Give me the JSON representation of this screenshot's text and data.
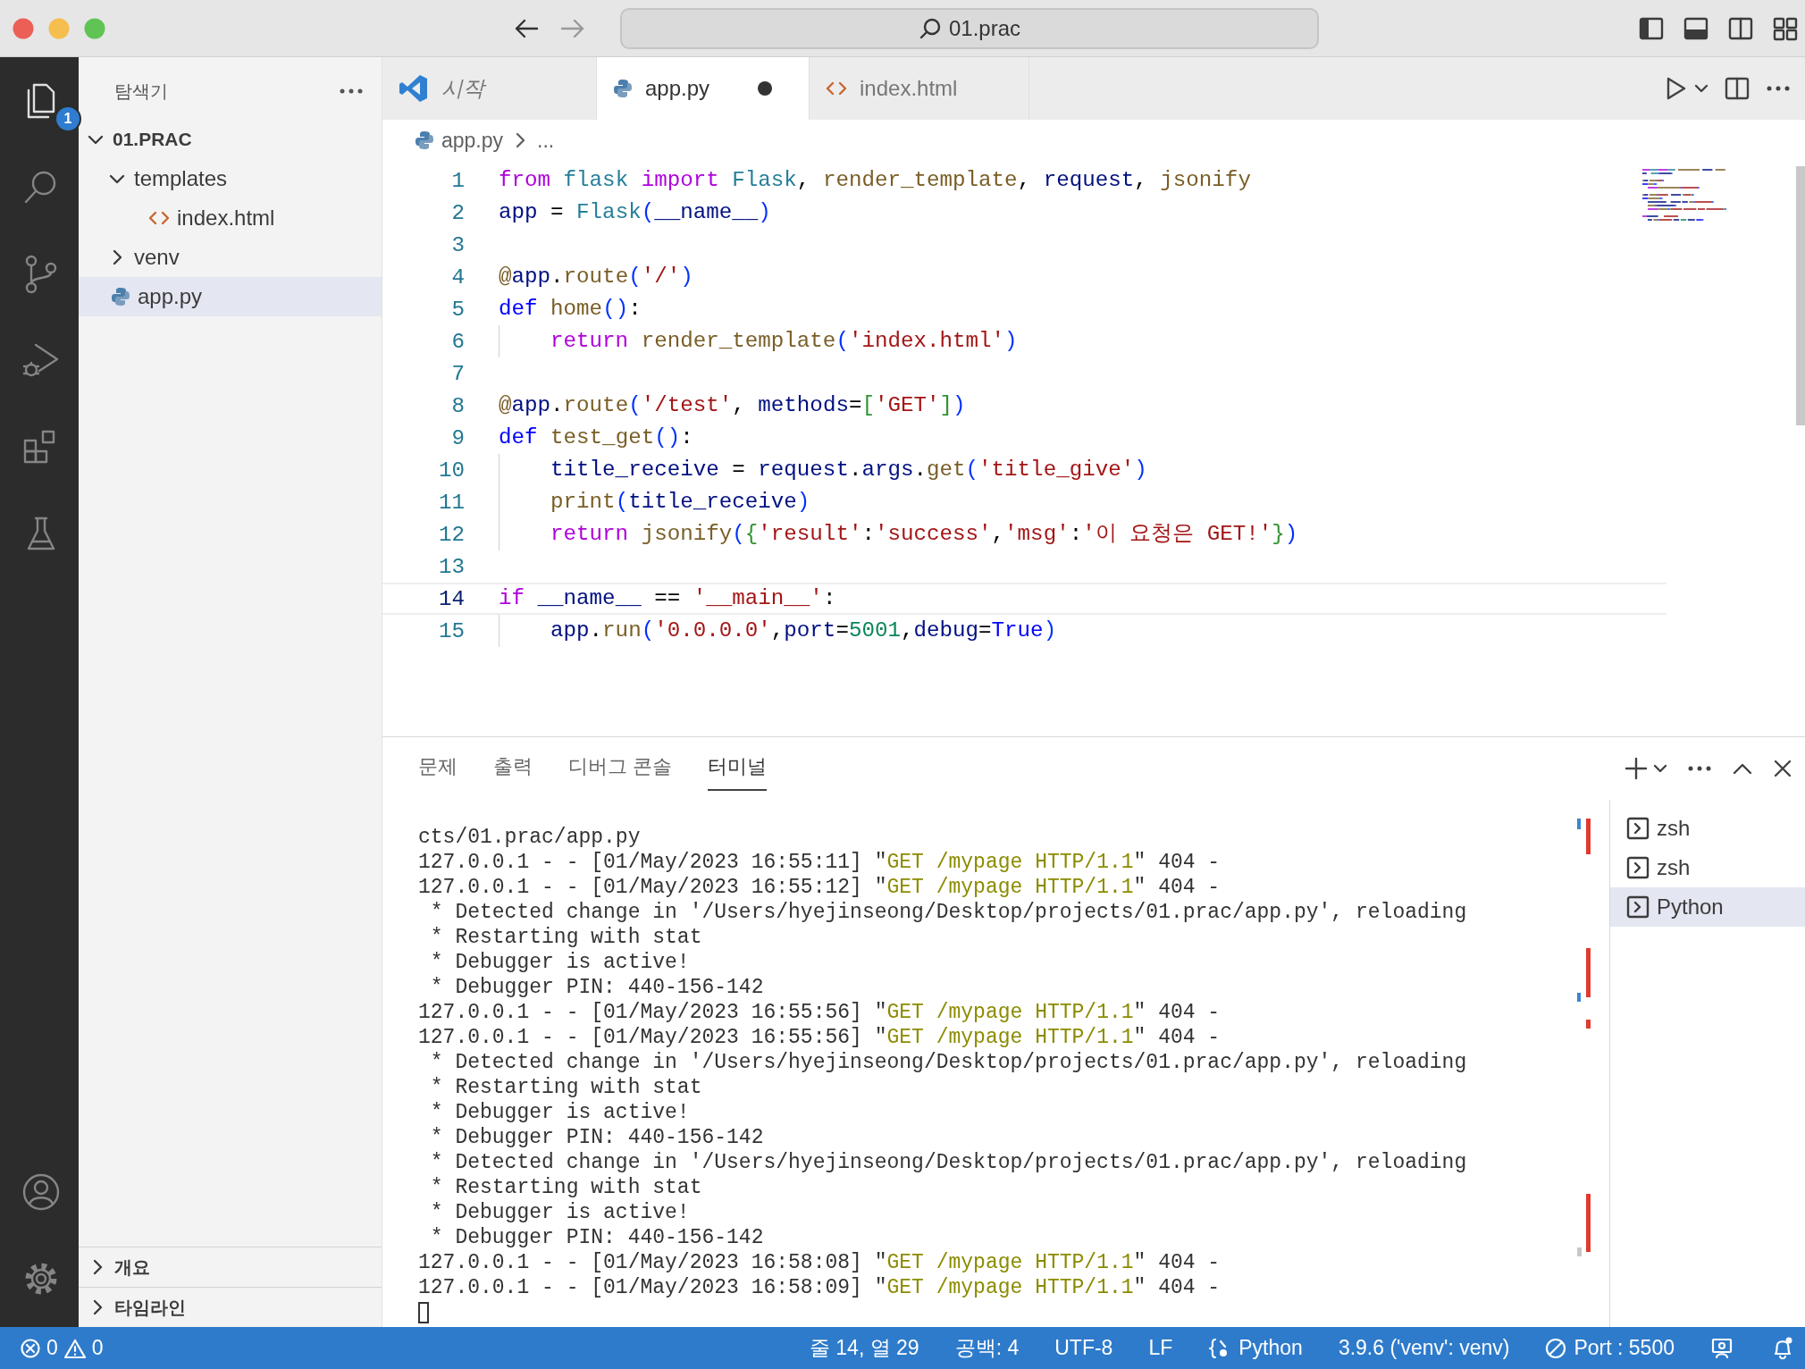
{
  "window": {
    "title": "01.prac"
  },
  "activity_bar": {
    "items": [
      {
        "kind": "explorer",
        "selected": true,
        "badge": "1"
      },
      {
        "kind": "search",
        "selected": false
      },
      {
        "kind": "source-control",
        "selected": false
      },
      {
        "kind": "run-debug",
        "selected": false
      },
      {
        "kind": "extensions",
        "selected": false
      },
      {
        "kind": "testing",
        "selected": false
      }
    ],
    "bottom": [
      {
        "kind": "account"
      },
      {
        "kind": "settings"
      }
    ]
  },
  "sidebar": {
    "title": "탐색기",
    "tree": [
      {
        "label": "01.PRAC",
        "kind": "root",
        "expanded": true,
        "selected": false,
        "children": [
          {
            "label": "templates",
            "kind": "folder",
            "expanded": true,
            "selected": false,
            "children": [
              {
                "label": "index.html",
                "kind": "html",
                "selected": false
              }
            ]
          },
          {
            "label": "venv",
            "kind": "folder",
            "expanded": false,
            "selected": false
          },
          {
            "label": "app.py",
            "kind": "python",
            "selected": true
          }
        ]
      }
    ],
    "sections": [
      {
        "label": "개요",
        "expanded": false
      },
      {
        "label": "타임라인",
        "expanded": false
      }
    ]
  },
  "tabs": [
    {
      "label": "시작",
      "kind": "welcome",
      "selected": false,
      "modified": false
    },
    {
      "label": "app.py",
      "kind": "python",
      "selected": true,
      "modified": true
    },
    {
      "label": "index.html",
      "kind": "html",
      "selected": false,
      "modified": false
    }
  ],
  "breadcrumb": {
    "items": [
      "app.py",
      "..."
    ]
  },
  "editor": {
    "lines": [
      {
        "number": "1",
        "current": false,
        "indented": false,
        "tokens": [
          {
            "kind": "keyword",
            "text": "from "
          },
          {
            "kind": "class",
            "text": "flask "
          },
          {
            "kind": "keyword",
            "text": "import "
          },
          {
            "kind": "class",
            "text": "Flask"
          },
          {
            "kind": "plain",
            "text": ", "
          },
          {
            "kind": "function",
            "text": "render_template"
          },
          {
            "kind": "plain",
            "text": ", "
          },
          {
            "kind": "variable",
            "text": "request"
          },
          {
            "kind": "plain",
            "text": ", "
          },
          {
            "kind": "function",
            "text": "jsonify"
          }
        ]
      },
      {
        "number": "2",
        "current": false,
        "indented": false,
        "tokens": [
          {
            "kind": "variable",
            "text": "app"
          },
          {
            "kind": "plain",
            "text": " = "
          },
          {
            "kind": "class",
            "text": "Flask"
          },
          {
            "kind": "bracket",
            "text": "("
          },
          {
            "kind": "variable",
            "text": "__name__"
          },
          {
            "kind": "bracket",
            "text": ")"
          }
        ]
      },
      {
        "number": "3",
        "current": false,
        "indented": false
      },
      {
        "number": "4",
        "current": false,
        "indented": false,
        "tokens": [
          {
            "kind": "function",
            "text": "@"
          },
          {
            "kind": "variable",
            "text": "app"
          },
          {
            "kind": "plain",
            "text": "."
          },
          {
            "kind": "function",
            "text": "route"
          },
          {
            "kind": "bracket",
            "text": "("
          },
          {
            "kind": "string",
            "text": "'/'"
          },
          {
            "kind": "bracket",
            "text": ")"
          }
        ]
      },
      {
        "number": "5",
        "current": false,
        "indented": false,
        "tokens": [
          {
            "kind": "storage",
            "text": "def "
          },
          {
            "kind": "function",
            "text": "home"
          },
          {
            "kind": "bracket",
            "text": "()"
          },
          {
            "kind": "plain",
            "text": ":"
          }
        ]
      },
      {
        "number": "6",
        "current": false,
        "indented": true,
        "tokens": [
          {
            "kind": "keyword",
            "text": "return "
          },
          {
            "kind": "function",
            "text": "render_template"
          },
          {
            "kind": "bracket",
            "text": "("
          },
          {
            "kind": "string",
            "text": "'index.html'"
          },
          {
            "kind": "bracket",
            "text": ")"
          }
        ]
      },
      {
        "number": "7",
        "current": false,
        "indented": false
      },
      {
        "number": "8",
        "current": false,
        "indented": false,
        "tokens": [
          {
            "kind": "function",
            "text": "@"
          },
          {
            "kind": "variable",
            "text": "app"
          },
          {
            "kind": "plain",
            "text": "."
          },
          {
            "kind": "function",
            "text": "route"
          },
          {
            "kind": "bracket",
            "text": "("
          },
          {
            "kind": "string",
            "text": "'/test'"
          },
          {
            "kind": "plain",
            "text": ", "
          },
          {
            "kind": "variable",
            "text": "methods"
          },
          {
            "kind": "plain",
            "text": "="
          },
          {
            "kind": "bracket2",
            "text": "["
          },
          {
            "kind": "string",
            "text": "'GET'"
          },
          {
            "kind": "bracket2",
            "text": "]"
          },
          {
            "kind": "bracket",
            "text": ")"
          }
        ]
      },
      {
        "number": "9",
        "current": false,
        "indented": false,
        "tokens": [
          {
            "kind": "storage",
            "text": "def "
          },
          {
            "kind": "function",
            "text": "test_get"
          },
          {
            "kind": "bracket",
            "text": "()"
          },
          {
            "kind": "plain",
            "text": ":"
          }
        ]
      },
      {
        "number": "10",
        "current": false,
        "indented": true,
        "tokens": [
          {
            "kind": "variable",
            "text": "title_receive"
          },
          {
            "kind": "plain",
            "text": " = "
          },
          {
            "kind": "variable",
            "text": "request"
          },
          {
            "kind": "plain",
            "text": "."
          },
          {
            "kind": "variable",
            "text": "args"
          },
          {
            "kind": "plain",
            "text": "."
          },
          {
            "kind": "function",
            "text": "get"
          },
          {
            "kind": "bracket",
            "text": "("
          },
          {
            "kind": "string",
            "text": "'title_give'"
          },
          {
            "kind": "bracket",
            "text": ")"
          }
        ]
      },
      {
        "number": "11",
        "current": false,
        "indented": true,
        "tokens": [
          {
            "kind": "function",
            "text": "print"
          },
          {
            "kind": "bracket",
            "text": "("
          },
          {
            "kind": "variable",
            "text": "title_receive"
          },
          {
            "kind": "bracket",
            "text": ")"
          }
        ]
      },
      {
        "number": "12",
        "current": false,
        "indented": true,
        "tokens": [
          {
            "kind": "keyword",
            "text": "return "
          },
          {
            "kind": "function",
            "text": "jsonify"
          },
          {
            "kind": "bracket",
            "text": "("
          },
          {
            "kind": "bracket2",
            "text": "{"
          },
          {
            "kind": "string",
            "text": "'result'"
          },
          {
            "kind": "plain",
            "text": ":"
          },
          {
            "kind": "string",
            "text": "'success'"
          },
          {
            "kind": "plain",
            "text": ","
          },
          {
            "kind": "string",
            "text": "'msg'"
          },
          {
            "kind": "plain",
            "text": ":"
          },
          {
            "kind": "string",
            "text": "'이 요청은 GET!'"
          },
          {
            "kind": "bracket2",
            "text": "}"
          },
          {
            "kind": "bracket",
            "text": ")"
          }
        ]
      },
      {
        "number": "13",
        "current": false,
        "indented": false
      },
      {
        "number": "14",
        "current": true,
        "indented": false,
        "tokens": [
          {
            "kind": "keyword",
            "text": "if "
          },
          {
            "kind": "variable",
            "text": "__name__"
          },
          {
            "kind": "plain",
            "text": " == "
          },
          {
            "kind": "string",
            "text": "'__main__'"
          },
          {
            "kind": "plain",
            "text": ":"
          }
        ]
      },
      {
        "number": "15",
        "current": false,
        "indented": true,
        "tokens": [
          {
            "kind": "variable",
            "text": "app"
          },
          {
            "kind": "plain",
            "text": "."
          },
          {
            "kind": "function",
            "text": "run"
          },
          {
            "kind": "bracket",
            "text": "("
          },
          {
            "kind": "string",
            "text": "'0.0.0.0'"
          },
          {
            "kind": "plain",
            "text": ","
          },
          {
            "kind": "variable",
            "text": "port"
          },
          {
            "kind": "plain",
            "text": "="
          },
          {
            "kind": "number",
            "text": "5001"
          },
          {
            "kind": "plain",
            "text": ","
          },
          {
            "kind": "variable",
            "text": "debug"
          },
          {
            "kind": "plain",
            "text": "="
          },
          {
            "kind": "storage",
            "text": "True"
          },
          {
            "kind": "bracket",
            "text": ")"
          }
        ]
      }
    ]
  },
  "panel": {
    "tabs": [
      {
        "label": "문제",
        "selected": false
      },
      {
        "label": "출력",
        "selected": false
      },
      {
        "label": "디버그 콘솔",
        "selected": false
      },
      {
        "label": "터미널",
        "selected": true
      }
    ],
    "terminal": {
      "lines": [
        [
          {
            "kind": "plain",
            "text": "cts/01.prac/app.py"
          }
        ],
        [
          {
            "kind": "plain",
            "text": "127.0.0.1 - - [01/May/2023 16:55:11] \""
          },
          {
            "kind": "request",
            "text": "GET /mypage HTTP/1.1"
          },
          {
            "kind": "plain",
            "text": "\" 404 -"
          }
        ],
        [
          {
            "kind": "plain",
            "text": "127.0.0.1 - - [01/May/2023 16:55:12] \""
          },
          {
            "kind": "request",
            "text": "GET /mypage HTTP/1.1"
          },
          {
            "kind": "plain",
            "text": "\" 404 -"
          }
        ],
        [
          {
            "kind": "plain",
            "text": " * Detected change in '/Users/hyejinseong/Desktop/projects/01.prac/app.py', reloading"
          }
        ],
        [
          {
            "kind": "plain",
            "text": " * Restarting with stat"
          }
        ],
        [
          {
            "kind": "plain",
            "text": " * Debugger is active!"
          }
        ],
        [
          {
            "kind": "plain",
            "text": " * Debugger PIN: 440-156-142"
          }
        ],
        [
          {
            "kind": "plain",
            "text": "127.0.0.1 - - [01/May/2023 16:55:56] \""
          },
          {
            "kind": "request",
            "text": "GET /mypage HTTP/1.1"
          },
          {
            "kind": "plain",
            "text": "\" 404 -"
          }
        ],
        [
          {
            "kind": "plain",
            "text": "127.0.0.1 - - [01/May/2023 16:55:56] \""
          },
          {
            "kind": "request",
            "text": "GET /mypage HTTP/1.1"
          },
          {
            "kind": "plain",
            "text": "\" 404 -"
          }
        ],
        [
          {
            "kind": "plain",
            "text": " * Detected change in '/Users/hyejinseong/Desktop/projects/01.prac/app.py', reloading"
          }
        ],
        [
          {
            "kind": "plain",
            "text": " * Restarting with stat"
          }
        ],
        [
          {
            "kind": "plain",
            "text": " * Debugger is active!"
          }
        ],
        [
          {
            "kind": "plain",
            "text": " * Debugger PIN: 440-156-142"
          }
        ],
        [
          {
            "kind": "plain",
            "text": " * Detected change in '/Users/hyejinseong/Desktop/projects/01.prac/app.py', reloading"
          }
        ],
        [
          {
            "kind": "plain",
            "text": " * Restarting with stat"
          }
        ],
        [
          {
            "kind": "plain",
            "text": " * Debugger is active!"
          }
        ],
        [
          {
            "kind": "plain",
            "text": " * Debugger PIN: 440-156-142"
          }
        ],
        [
          {
            "kind": "plain",
            "text": "127.0.0.1 - - [01/May/2023 16:58:08] \""
          },
          {
            "kind": "request",
            "text": "GET /mypage HTTP/1.1"
          },
          {
            "kind": "plain",
            "text": "\" 404 -"
          }
        ],
        [
          {
            "kind": "plain",
            "text": "127.0.0.1 - - [01/May/2023 16:58:09] \""
          },
          {
            "kind": "request",
            "text": "GET /mypage HTTP/1.1"
          },
          {
            "kind": "plain",
            "text": "\" 404 -"
          }
        ]
      ]
    },
    "sessions": [
      {
        "label": "zsh",
        "selected": false
      },
      {
        "label": "zsh",
        "selected": false
      },
      {
        "label": "Python",
        "selected": true
      }
    ]
  },
  "status_bar": {
    "errors": "0",
    "warnings": "0",
    "items": [
      {
        "kind": "plain",
        "text": "줄 14, 열 29"
      },
      {
        "kind": "plain",
        "text": "공백: 4"
      },
      {
        "kind": "plain",
        "text": "UTF-8"
      },
      {
        "kind": "plain",
        "text": "LF"
      },
      {
        "kind": "language",
        "text": "Python"
      },
      {
        "kind": "plain",
        "text": "3.9.6 ('venv': venv)"
      },
      {
        "kind": "port",
        "text": "Port : 5500"
      }
    ]
  }
}
